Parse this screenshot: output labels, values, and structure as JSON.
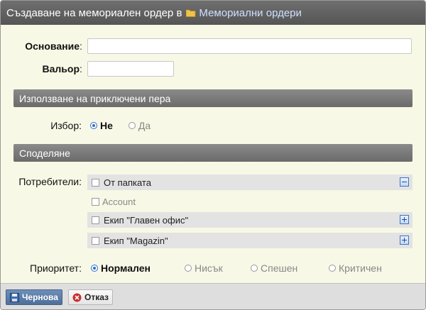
{
  "title": {
    "prefix": "Създаване на мемориален ордер в",
    "folder_link": "Мемориални ордери"
  },
  "form": {
    "basis_label": "Основание",
    "basis_value": "",
    "valeur_label": "Вальор",
    "valeur_value": "",
    "colon": ":"
  },
  "sections": {
    "used_items": "Използване на приключени пера",
    "sharing": "Споделяне"
  },
  "choice": {
    "label": "Избор:",
    "options": [
      {
        "label": "Не",
        "selected": true
      },
      {
        "label": "Да",
        "selected": false
      }
    ]
  },
  "users": {
    "label": "Потребители:",
    "groups": [
      {
        "label": "От папката",
        "toggle": "collapse"
      },
      {
        "label": "Account"
      },
      {
        "label": "Екип \"Главен офис\"",
        "toggle": "expand"
      },
      {
        "label": "Екип \"Magazin\"",
        "toggle": "expand"
      }
    ]
  },
  "priority": {
    "label": "Приоритет:",
    "options": [
      {
        "label": "Нормален",
        "selected": true
      },
      {
        "label": "Нисък",
        "selected": false
      },
      {
        "label": "Спешен",
        "selected": false
      },
      {
        "label": "Критичен",
        "selected": false
      }
    ]
  },
  "buttons": {
    "draft": "Чернова",
    "cancel": "Отказ"
  },
  "colors": {
    "title_bg": "#5e5e5e",
    "section_bg": "#7a7a7a",
    "accent": "#2a6fcf",
    "panel_bg": "#f8f8e6"
  }
}
